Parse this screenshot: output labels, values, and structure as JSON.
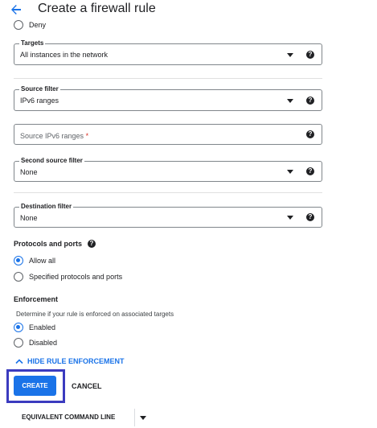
{
  "header": {
    "title": "Create a firewall rule"
  },
  "action": {
    "deny_label": "Deny"
  },
  "targets": {
    "legend": "Targets",
    "value": "All instances in the network"
  },
  "source_filter": {
    "legend": "Source filter",
    "value": "IPv6 ranges"
  },
  "source_ranges": {
    "placeholder": "Source IPv6 ranges",
    "required_mark": "*"
  },
  "second_source_filter": {
    "legend": "Second source filter",
    "value": "None"
  },
  "destination_filter": {
    "legend": "Destination filter",
    "value": "None"
  },
  "protocols": {
    "title": "Protocols and ports",
    "allow_all": "Allow all",
    "specified": "Specified protocols and ports",
    "selected": "allow_all"
  },
  "enforcement": {
    "title": "Enforcement",
    "helper": "Determine if your rule is enforced on associated targets",
    "enabled": "Enabled",
    "disabled": "Disabled",
    "selected": "enabled",
    "toggle_label": "HIDE RULE ENFORCEMENT"
  },
  "buttons": {
    "create": "CREATE",
    "cancel": "CANCEL",
    "equivalent": "EQUIVALENT COMMAND LINE"
  },
  "colors": {
    "accent": "#1a73e8",
    "highlight_frame": "#3b3bbf"
  }
}
